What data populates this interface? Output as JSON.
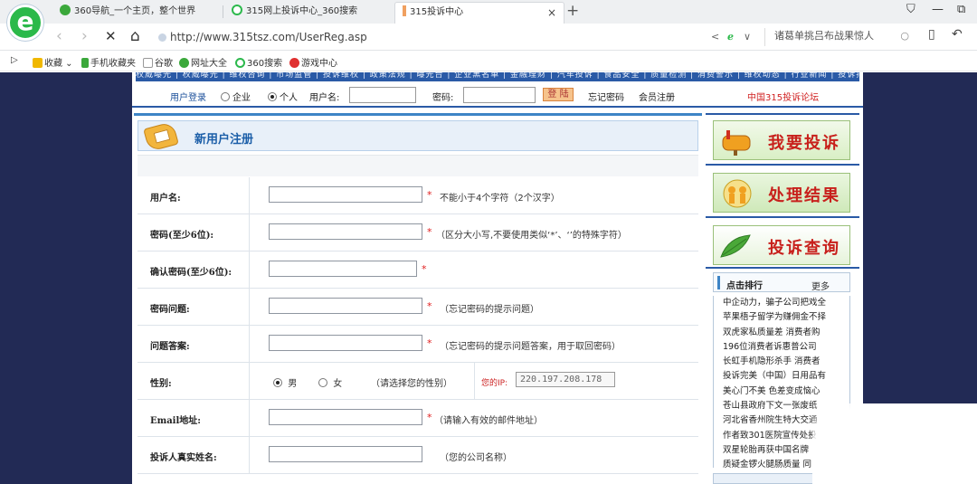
{
  "browser": {
    "logo_glyph": "e",
    "tabs": [
      {
        "title": "360导航_一个主页，整个世界",
        "icon_color": "#3ba83b"
      },
      {
        "title": "315网上投诉中心_360搜索",
        "icon_color": "#2db94d"
      },
      {
        "title": "315投诉中心",
        "icon_color": "#f0a060"
      }
    ],
    "tab_close": "×",
    "new_tab": "+",
    "window_controls": {
      "skin": "⛉",
      "minimize": "—",
      "maximize": "⧉"
    },
    "nav": {
      "back": "‹",
      "forward": "›",
      "stop": "✕",
      "home": "⌂"
    },
    "url": "http://www.315tsz.com/UserReg.asp",
    "search_text": "诸葛单挑吕布战果惊人",
    "search_icon": "○",
    "menu_icons": {
      "share": "<",
      "browser_mode": "ℯ",
      "more": "∨",
      "device": "▯",
      "undo": "↶"
    },
    "favorites": [
      {
        "label": "收藏",
        "color": "#f0b800"
      },
      {
        "label": "手机收藏夹",
        "color": "#3ba83b"
      },
      {
        "label": "谷歌",
        "color": "#999999"
      },
      {
        "label": "网址大全",
        "color": "#3ba83b"
      },
      {
        "label": "360搜索",
        "color": "#2db94d"
      },
      {
        "label": "游戏中心",
        "color": "#e03030"
      }
    ],
    "fav_toggle": "▷"
  },
  "site": {
    "top_nav_text": "权威曝光 | 权威曝光 | 维权咨询 | 市场监管 | 投诉维权 | 政策法规 | 曝光台 | 企业黑名单 | 金融理财 | 汽车投诉 | 食品安全 | 质量检测 | 消费警示 | 维权动态 | 行业新闻 | 投诉排行",
    "login": {
      "label": "用户登录",
      "option_company": "企业",
      "option_personal": "个人",
      "username_label": "用户名:",
      "password_label": "密码:",
      "button": "登 陆",
      "forgot": "忘记密码",
      "register": "会员注册",
      "forum": "中国315投诉论坛"
    },
    "page_title": "新用户注册",
    "form": {
      "rows": [
        {
          "label": "用户名:",
          "hint": "不能小于4个字符（2个汉字）",
          "required": "*"
        },
        {
          "label": "密码(至少6位):",
          "hint": "（区分大小写,不要使用类似‘*’、‘’的特殊字符）",
          "required": "*"
        },
        {
          "label": "确认密码(至少6位):",
          "hint": "",
          "required": "*"
        },
        {
          "label": "密码问题:",
          "hint": "（忘记密码的提示问题）",
          "required": "*"
        },
        {
          "label": "问题答案:",
          "hint": "（忘记密码的提示问题答案，用于取回密码）",
          "required": "*"
        },
        {
          "label": "性别:",
          "hint": "",
          "required": ""
        },
        {
          "label": "Email地址:",
          "hint": "（请输入有效的邮件地址）",
          "required": "*"
        },
        {
          "label": "投诉人真实姓名:",
          "hint": "（您的公司名称）",
          "required": ""
        }
      ],
      "gender": {
        "male": "男",
        "female": "女",
        "hint": "（请选择您的性别）"
      },
      "ip_label": "您的IP:",
      "ip_value": "220.197.208.178"
    },
    "sidebar": {
      "banners": [
        "我要投诉",
        "处理结果",
        "投诉查询"
      ],
      "rank_title": "点击排行",
      "rank_more": "更多",
      "rank_items": [
        "中企动力，骗子公司把戏全",
        "苹果梧子留学为赚佣金不择",
        "双虎家私质量差 消费者购",
        "196位消费者诉惠普公司",
        "长虹手机隐形杀手 消费者",
        "投诉完美（中国）日用品有",
        "美心门不美 色差变成恼心",
        "苍山县政府下文一张废纸",
        "河北省香州院生特大交通",
        "作者致301医院宣传处投",
        "双星轮胎再获中国名牌",
        "质疑金锣火腿肠质量 同"
      ]
    }
  }
}
